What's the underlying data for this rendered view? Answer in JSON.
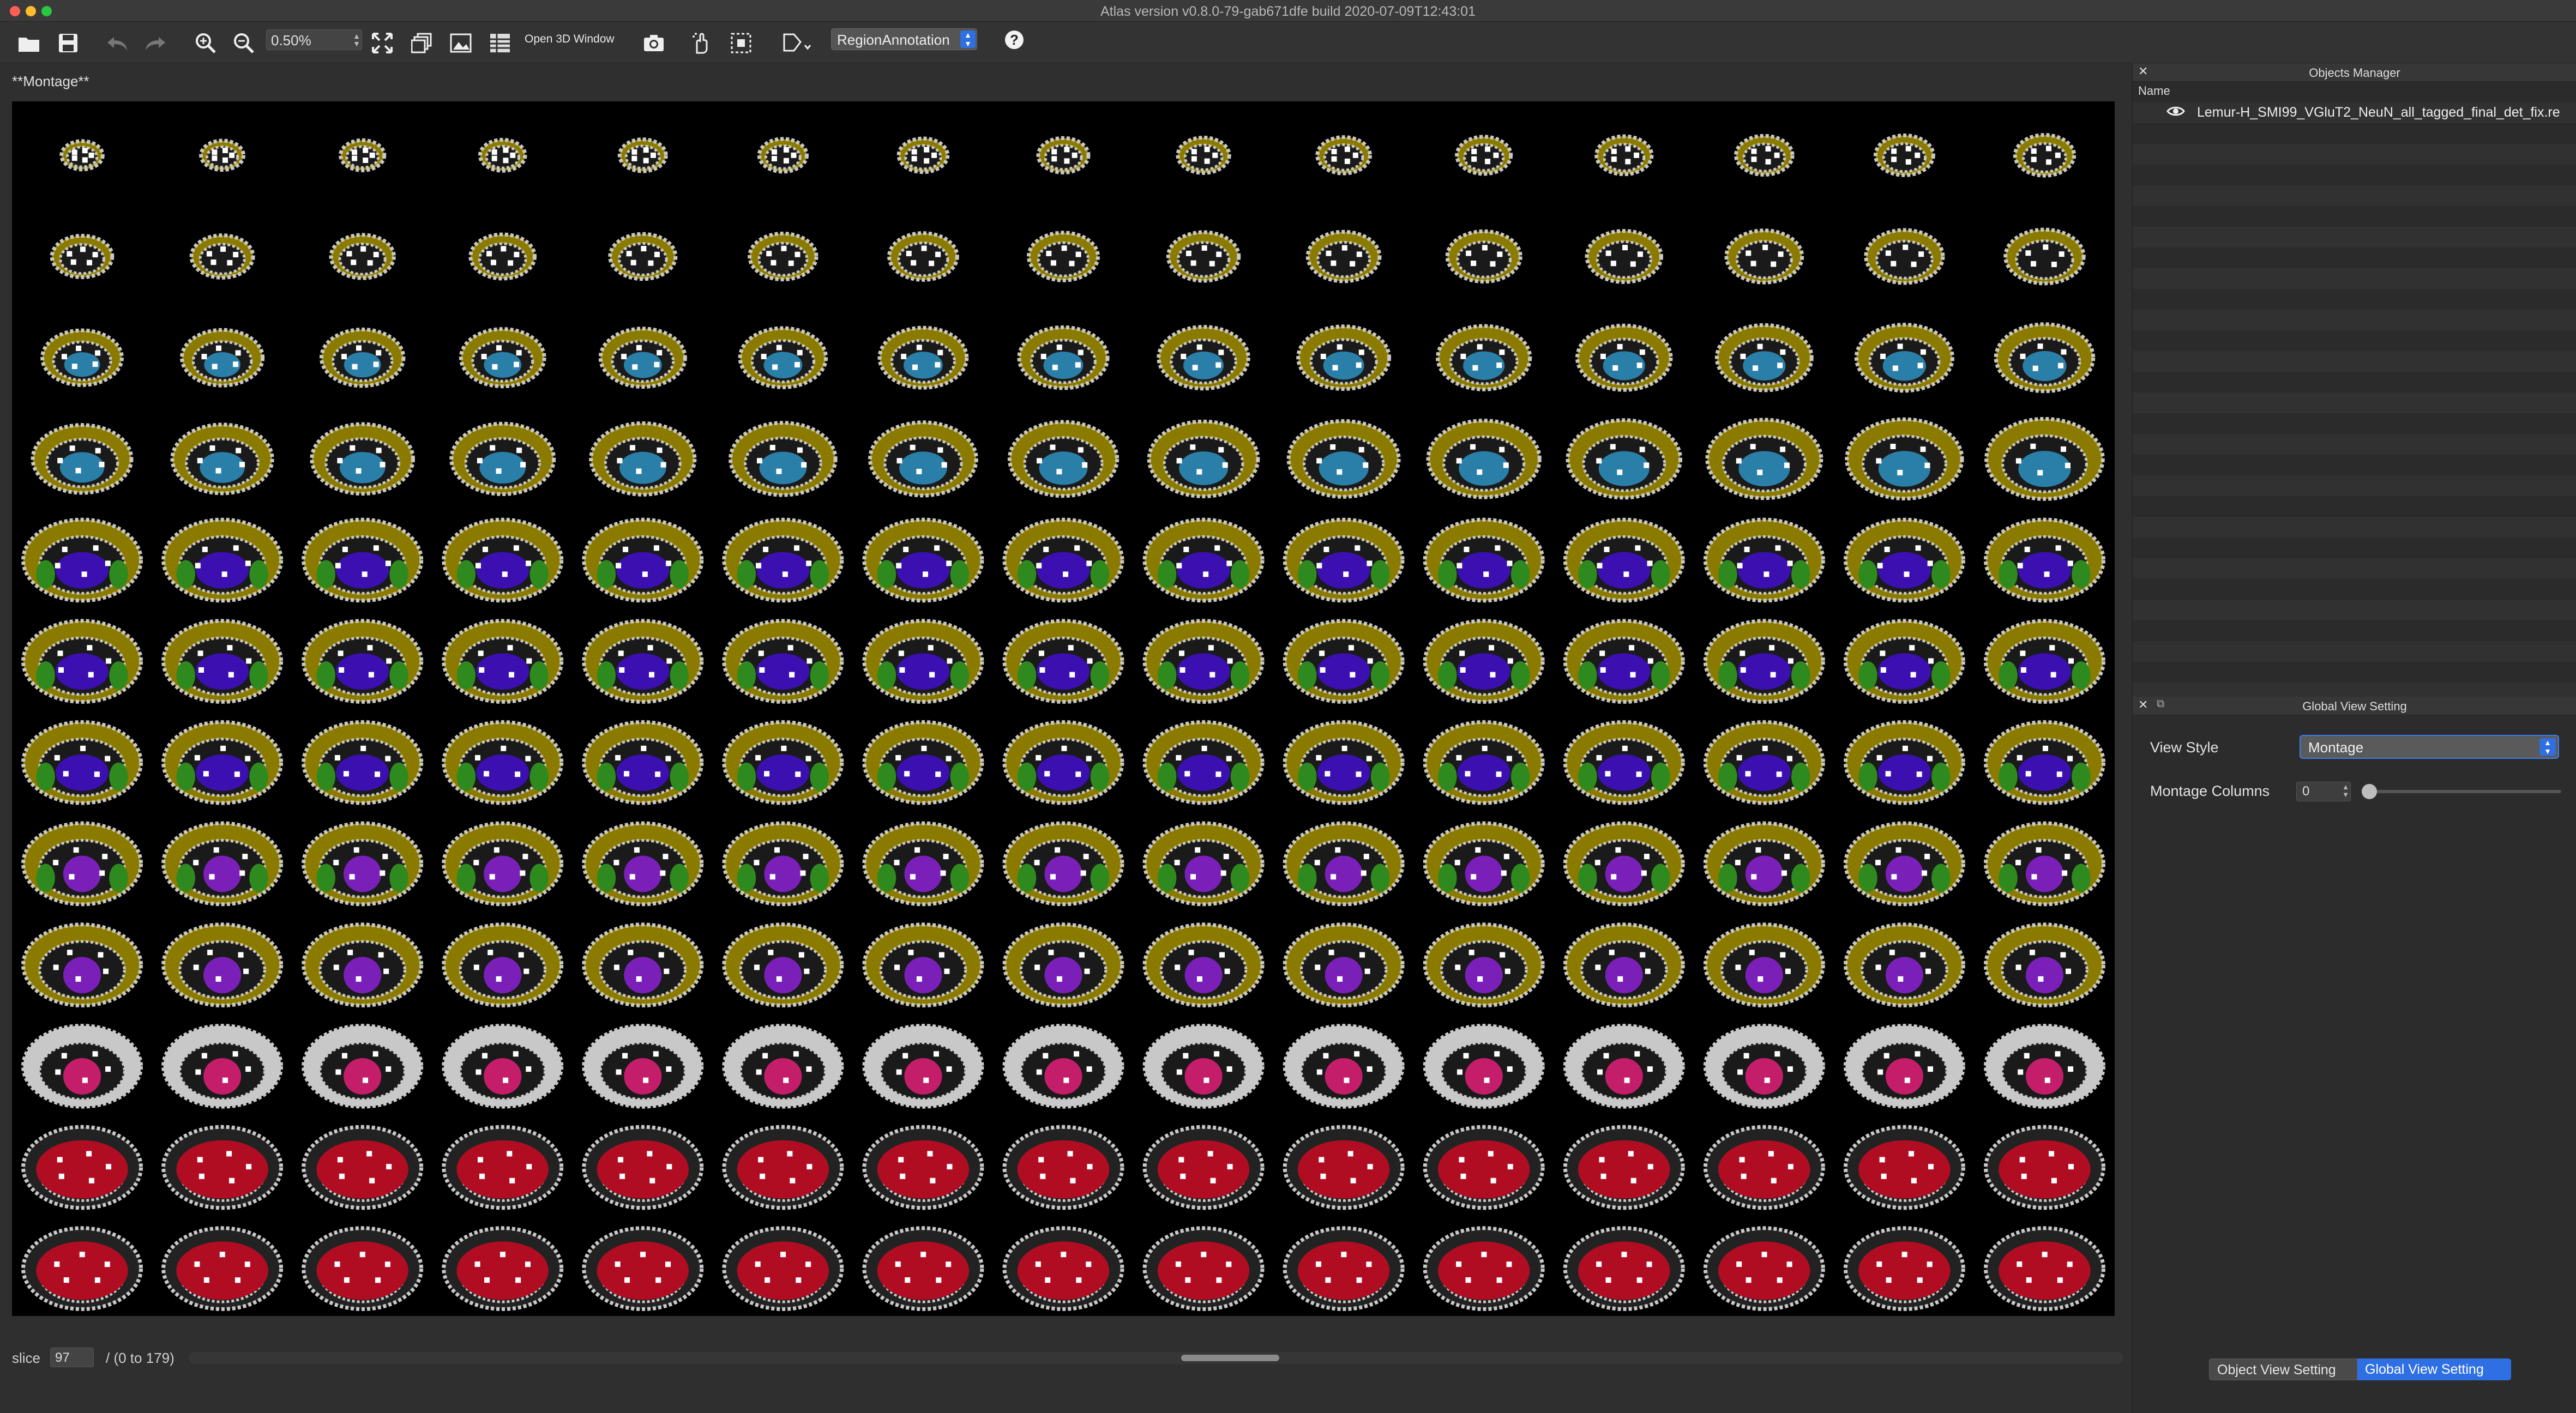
{
  "window": {
    "title": "Atlas version v0.8.0-79-gab671dfe build 2020-07-09T12:43:01"
  },
  "toolbar": {
    "zoom_value": "0.50%",
    "open_3d_label": "Open 3D Window",
    "annotation_mode": "RegionAnnotation",
    "help_label": "?"
  },
  "viewer": {
    "tab_title": "**Montage**",
    "slice_label": "slice",
    "slice_value": "97",
    "slice_range": "/ (0 to 179)"
  },
  "objects_manager": {
    "title": "Objects Manager",
    "column_name": "Name",
    "items": [
      {
        "name": "Lemur-H_SMI99_VGluT2_NeuN_all_tagged_final_det_fix.re"
      }
    ]
  },
  "global_view": {
    "title": "Global View Setting",
    "view_style_label": "View Style",
    "view_style_value": "Montage",
    "montage_columns_label": "Montage Columns",
    "montage_columns_value": "0",
    "montage_columns_slider": 0
  },
  "bottom_tabs": {
    "object_view": "Object View Setting",
    "global_view": "Global View Setting"
  },
  "colors": {
    "cortex": "#8b7a00",
    "outline": "#c8c8c8",
    "striatum": "#3b0fb0",
    "thalamus": "#7a1fb8",
    "hippocampus": "#2e8a1e",
    "midbrain": "#c41e6a",
    "cerebellum": "#b10d22",
    "olfactory": "#2a7fa8",
    "accent": "#2e6fe3"
  }
}
